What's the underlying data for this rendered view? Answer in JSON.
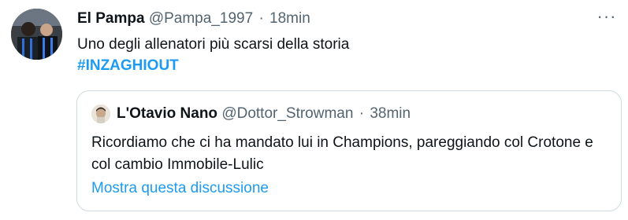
{
  "tweet": {
    "author_name": "El Pampa",
    "handle": "@Pampa_1997",
    "separator": "·",
    "time": "18min",
    "text": "Uno degli allenatori più scarsi della storia",
    "hashtag": "#INZAGHIOUT",
    "more_icon": "more-horizontal-icon"
  },
  "quoted": {
    "author_name": "L'Otavio Nano",
    "handle": "@Dottor_Strowman",
    "separator": "·",
    "time": "38min",
    "text": "Ricordiamo che ci ha mandato lui in Champions, pareggiando col Crotone e col cambio Immobile-Lulic",
    "show_thread_label": "Mostra questa discussione"
  },
  "colors": {
    "accent": "#1d9bf0",
    "text_primary": "#0f1419",
    "text_secondary": "#536471",
    "border": "#cfd9de"
  }
}
